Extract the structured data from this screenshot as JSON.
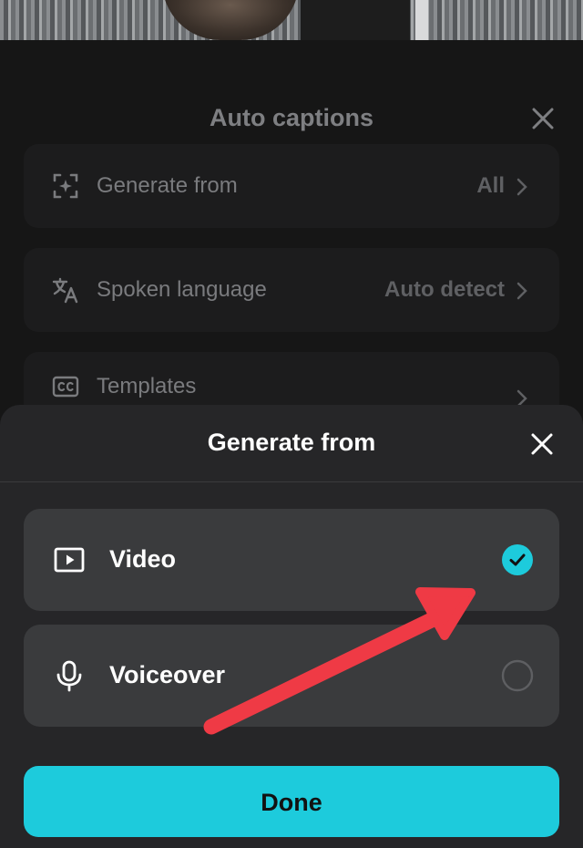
{
  "background_sheet": {
    "title": "Auto captions",
    "rows": [
      {
        "label": "Generate from",
        "value": "All"
      },
      {
        "label": "Spoken language",
        "value": "Auto detect"
      },
      {
        "label": "Templates",
        "value": ""
      }
    ]
  },
  "sheet": {
    "title": "Generate from",
    "options": [
      {
        "label": "Video",
        "icon": "video-play-icon",
        "selected": true
      },
      {
        "label": "Voiceover",
        "icon": "microphone-icon",
        "selected": false
      }
    ],
    "done_label": "Done"
  },
  "colors": {
    "accent": "#1dcbdc",
    "annotation_arrow": "#ef3a45",
    "sheet_background": "#262628",
    "option_background": "#3a3b3d"
  }
}
